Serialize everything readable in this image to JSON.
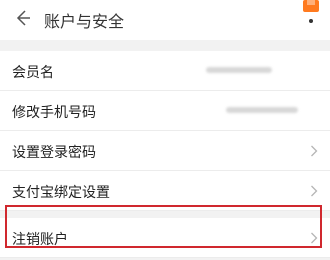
{
  "header": {
    "title": "账户与安全",
    "back_icon": "back-arrow-icon",
    "corner_icon": "orange-badge-icon"
  },
  "rows": [
    {
      "label": "会员名",
      "value": "(obscured)",
      "icon": null
    },
    {
      "label": "修改手机号码",
      "value": "(obscured)",
      "icon": null
    },
    {
      "label": "设置登录密码",
      "value": "",
      "icon": "chevron-right-icon"
    },
    {
      "label": "支付宝绑定设置",
      "value": "",
      "icon": "chevron-right-icon"
    },
    {
      "label": "注销账户",
      "value": "",
      "icon": "chevron-right-icon"
    }
  ],
  "colors": {
    "highlight": "#d0282e",
    "background": "#f2f2f2",
    "accent_orange": "#ff7a1f"
  }
}
